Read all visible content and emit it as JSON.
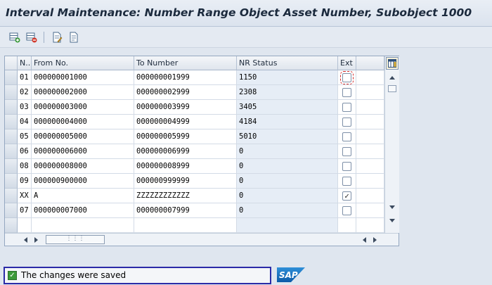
{
  "window": {
    "title": "Interval Maintenance: Number Range Object Asset Number, Subobject 1000"
  },
  "toolbar": {
    "buttons": [
      {
        "name": "insert-interval-button",
        "icon": "insert-row-icon"
      },
      {
        "name": "delete-interval-button",
        "icon": "delete-row-icon"
      },
      {
        "name": "change-status-button",
        "icon": "edit-document-icon"
      },
      {
        "name": "overview-button",
        "icon": "document-icon"
      }
    ]
  },
  "table": {
    "columns": [
      {
        "key": "no",
        "label": "N.."
      },
      {
        "key": "from",
        "label": "From No."
      },
      {
        "key": "to",
        "label": "To Number"
      },
      {
        "key": "status",
        "label": "NR Status"
      },
      {
        "key": "ext",
        "label": "Ext"
      }
    ],
    "rows": [
      {
        "no": "01",
        "from": "000000001000",
        "to": "000000001999",
        "status": "1150",
        "ext": false
      },
      {
        "no": "02",
        "from": "000000002000",
        "to": "000000002999",
        "status": "2308",
        "ext": false
      },
      {
        "no": "03",
        "from": "000000003000",
        "to": "000000003999",
        "status": "3405",
        "ext": false
      },
      {
        "no": "04",
        "from": "000000004000",
        "to": "000000004999",
        "status": "4184",
        "ext": false
      },
      {
        "no": "05",
        "from": "000000005000",
        "to": "000000005999",
        "status": "5010",
        "ext": false
      },
      {
        "no": "06",
        "from": "000000006000",
        "to": "000000006999",
        "status": "0",
        "ext": false
      },
      {
        "no": "08",
        "from": "000000008000",
        "to": "000000008999",
        "status": "0",
        "ext": false
      },
      {
        "no": "09",
        "from": "000000900000",
        "to": "000000999999",
        "status": "0",
        "ext": false
      },
      {
        "no": "XX",
        "from": "A",
        "to": "ZZZZZZZZZZZZ",
        "status": "0",
        "ext": true
      },
      {
        "no": "07",
        "from": "000000007000",
        "to": "000000007999",
        "status": "0",
        "ext": false
      }
    ],
    "empty_rows": 1
  },
  "statusbar": {
    "message": "The changes were saved"
  },
  "logo": {
    "text": "SAP"
  }
}
